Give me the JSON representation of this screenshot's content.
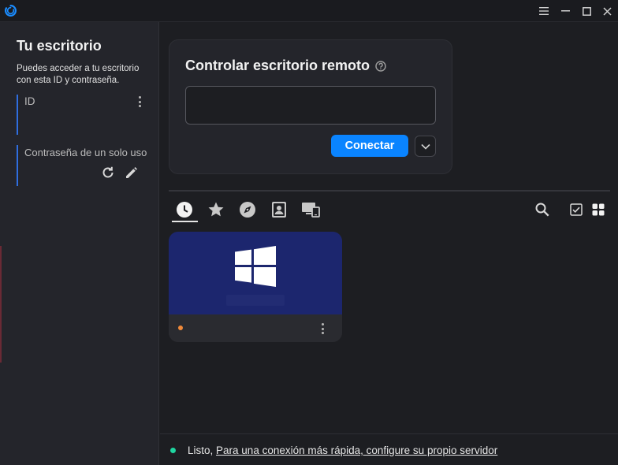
{
  "sidebar": {
    "title": "Tu escritorio",
    "description": "Puedes acceder a tu escritorio con esta ID y contraseña.",
    "id_label": "ID",
    "id_value": "",
    "password_label": "Contraseña de un solo uso",
    "password_value": ""
  },
  "remote": {
    "title": "Controlar escritorio remoto",
    "input_value": "",
    "input_placeholder": "",
    "connect_label": "Conectar"
  },
  "tabs": [
    {
      "icon": "clock-icon",
      "active": true
    },
    {
      "icon": "star-icon",
      "active": false
    },
    {
      "icon": "compass-icon",
      "active": false
    },
    {
      "icon": "address-book-icon",
      "active": false
    },
    {
      "icon": "devices-icon",
      "active": false
    }
  ],
  "peer": {
    "os": "windows-logo-icon",
    "status": "offline"
  },
  "status_bar": {
    "text": "Listo, ",
    "link": "Para una conexión más rápida, configure su propio servidor"
  },
  "colors": {
    "accent": "#0a84ff",
    "sidebar_bar": "#2f6ee0",
    "peer_bg": "#1c266e",
    "status_ok": "#1fd5a0",
    "peer_offline": "#f08a3a"
  }
}
